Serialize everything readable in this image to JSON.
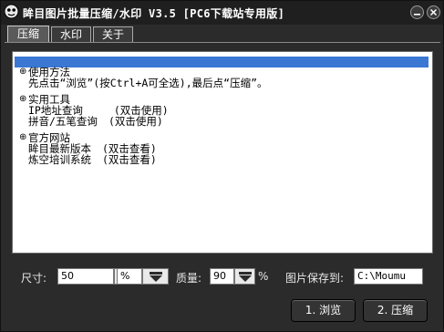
{
  "window": {
    "title": "眸目图片批量压缩/水印 V3.5  [PC6下载站专用版]"
  },
  "tabs": [
    {
      "label": "压缩",
      "active": true
    },
    {
      "label": "水印",
      "active": false
    },
    {
      "label": "关于",
      "active": false
    }
  ],
  "tree": [
    {
      "title": "使用方法",
      "items": [
        {
          "text": "先点击“浏览”(按Ctrl+A可全选),最后点“压缩”。",
          "hint": ""
        }
      ]
    },
    {
      "title": "实用工具",
      "items": [
        {
          "text": "IP地址查询",
          "hint": "(双击使用)"
        },
        {
          "text": "拼音/五笔查询",
          "hint": "(双击使用)"
        }
      ]
    },
    {
      "title": "官方网站",
      "items": [
        {
          "text": "眸目最新版本",
          "hint": "(双击查看)"
        },
        {
          "text": "炼空培训系统",
          "hint": "(双击查看)"
        }
      ]
    }
  ],
  "controls": {
    "size_label": "尺寸:",
    "size_value": "50",
    "unit_value": "%",
    "quality_label": "质量:",
    "quality_value": "90",
    "quality_unit": "%",
    "save_label": "图片保存到:",
    "save_path": "C:\\Moumu"
  },
  "buttons": {
    "browse": "1. 浏览",
    "compress": "2. 压缩"
  },
  "colors": {
    "selection": "#3a78d4",
    "background": "#2b2b2b"
  }
}
